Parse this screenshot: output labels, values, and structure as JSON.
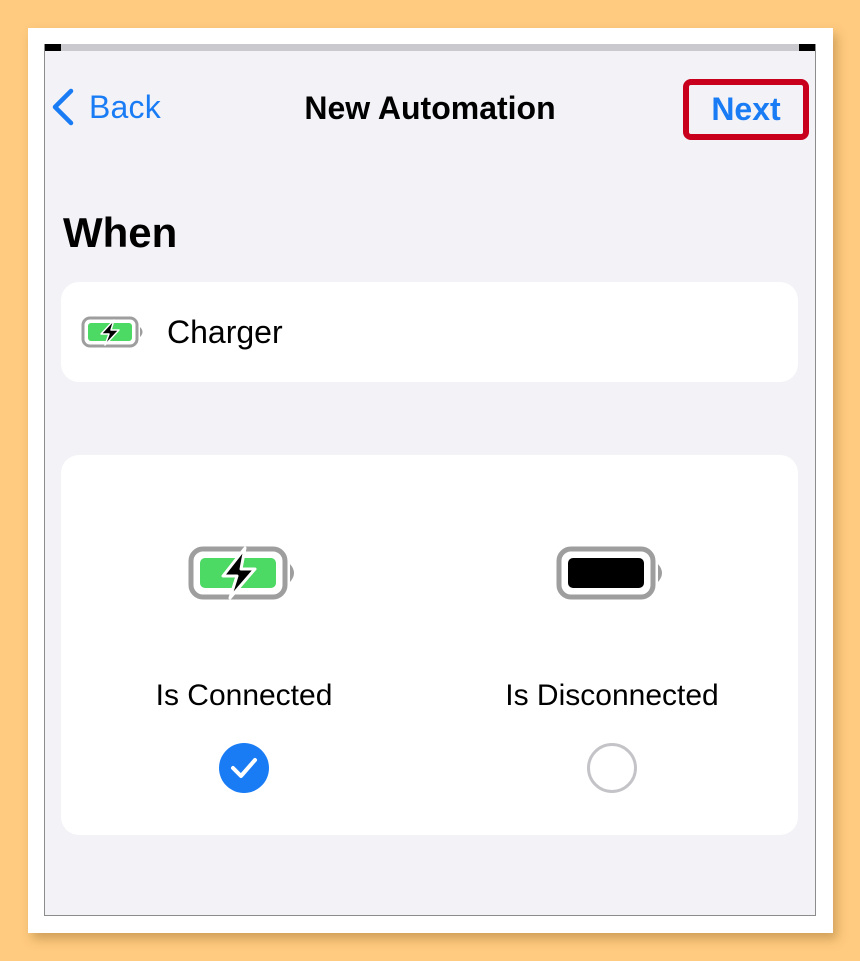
{
  "nav": {
    "back_label": "Back",
    "title": "New Automation",
    "next_label": "Next"
  },
  "section": {
    "title": "When"
  },
  "trigger": {
    "label": "Charger",
    "icon": "battery-charging-icon"
  },
  "options": [
    {
      "label": "Is Connected",
      "icon": "battery-charging-icon",
      "selected": true
    },
    {
      "label": "Is Disconnected",
      "icon": "battery-full-icon",
      "selected": false
    }
  ],
  "colors": {
    "accent": "#1a7cf5",
    "highlight_box": "#c8001e",
    "battery_green": "#4cd964",
    "background": "#f2f2f7",
    "card": "#ffffff",
    "frame_outer": "#ffcb80"
  }
}
